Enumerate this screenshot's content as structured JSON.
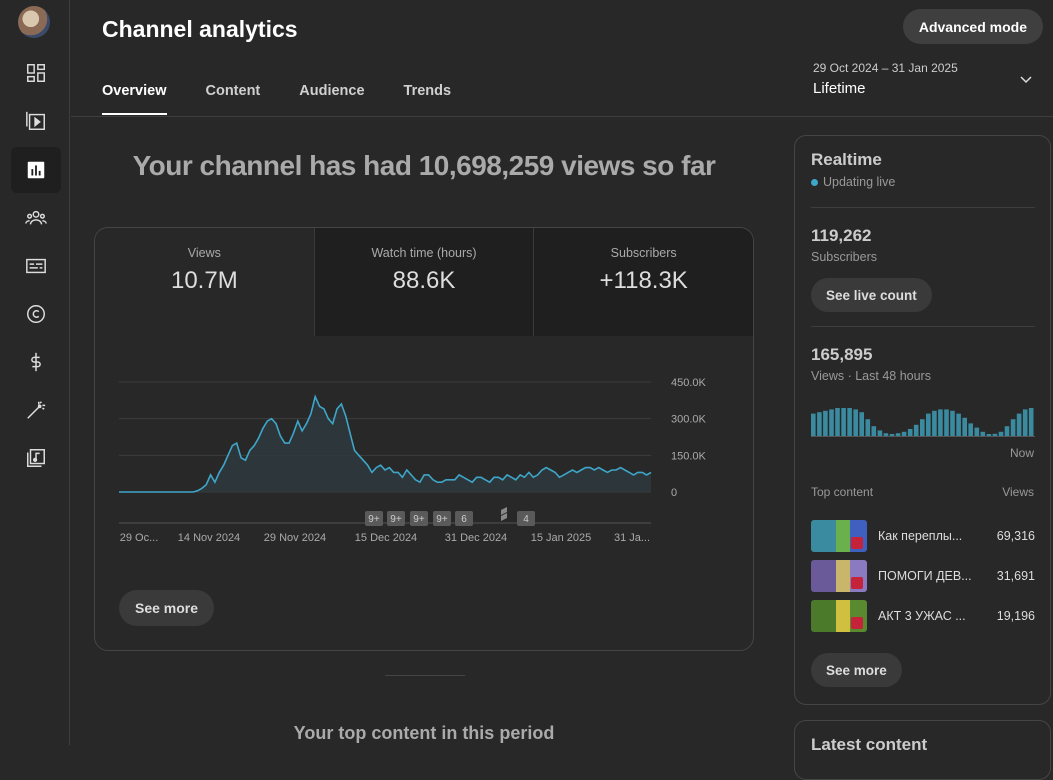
{
  "app": {
    "title": "Channel analytics",
    "advanced_mode": "Advanced mode"
  },
  "sidebar": {
    "items": [
      {
        "icon": "dashboard-icon"
      },
      {
        "icon": "content-icon"
      },
      {
        "icon": "analytics-icon",
        "active": true
      },
      {
        "icon": "community-icon"
      },
      {
        "icon": "subtitles-icon"
      },
      {
        "icon": "copyright-icon"
      },
      {
        "icon": "earn-icon"
      },
      {
        "icon": "customization-icon"
      },
      {
        "icon": "audio-library-icon"
      }
    ]
  },
  "tabs": [
    {
      "label": "Overview",
      "active": true
    },
    {
      "label": "Content"
    },
    {
      "label": "Audience"
    },
    {
      "label": "Trends"
    }
  ],
  "date_filter": {
    "range": "29 Oct 2024 – 31 Jan 2025",
    "value": "Lifetime"
  },
  "headline": "Your channel has had 10,698,259 views so far",
  "metrics": [
    {
      "label": "Views",
      "value": "10.7M"
    },
    {
      "label": "Watch time (hours)",
      "value": "88.6K"
    },
    {
      "label": "Subscribers",
      "value": "+118.3K"
    }
  ],
  "chart_data": {
    "type": "area",
    "series": [
      {
        "values": [
          0,
          0,
          0,
          0,
          0,
          0,
          0,
          0,
          0,
          0,
          0,
          0,
          0,
          0,
          0,
          0,
          0,
          0,
          5000,
          15000,
          30000,
          70000,
          40000,
          80000,
          110000,
          150000,
          190000,
          200000,
          140000,
          130000,
          170000,
          190000,
          220000,
          260000,
          290000,
          300000,
          280000,
          230000,
          200000,
          200000,
          240000,
          290000,
          250000,
          280000,
          320000,
          390000,
          350000,
          340000,
          300000,
          280000,
          340000,
          360000,
          310000,
          240000,
          170000,
          150000,
          130000,
          110000,
          80000,
          100000,
          110000,
          90000,
          100000,
          80000,
          80000,
          60000,
          90000,
          70000,
          50000,
          40000,
          70000,
          70000,
          50000,
          40000,
          40000,
          50000,
          50000,
          50000,
          70000,
          60000,
          50000,
          40000,
          60000,
          60000,
          50000,
          40000,
          60000,
          60000,
          50000,
          70000,
          60000,
          50000,
          70000,
          60000,
          80000,
          60000,
          70000,
          90000,
          100000,
          90000,
          80000,
          60000,
          70000,
          80000,
          90000,
          80000,
          90000,
          100000,
          100000,
          90000,
          100000,
          90000,
          80000,
          90000,
          90000,
          100000,
          90000,
          80000,
          70000,
          80000,
          80000,
          70000,
          80000
        ]
      }
    ],
    "x_ticks": [
      "29 Oc...",
      "14 Nov 2024",
      "29 Nov 2024",
      "15 Dec 2024",
      "31 Dec 2024",
      "15 Jan 2025",
      "31 Ja..."
    ],
    "y_ticks": [
      "450.0K",
      "300.0K",
      "150.0K",
      "0"
    ],
    "ylim": [
      0,
      450000
    ],
    "grid": true,
    "markers": [
      "9+",
      "9+",
      "9+",
      "9+",
      "6",
      "4"
    ]
  },
  "see_more": "See more",
  "top_content_title": "Your top content in this period",
  "realtime": {
    "title": "Realtime",
    "status": "Updating live",
    "subscribers_value": "119,262",
    "subscribers_label": "Subscribers",
    "live_count_btn": "See live count",
    "views_value": "165,895",
    "views_label": "Views · Last 48 hours",
    "bars": [
      80,
      85,
      90,
      95,
      100,
      100,
      100,
      95,
      85,
      60,
      35,
      20,
      10,
      5,
      10,
      15,
      25,
      40,
      60,
      80,
      90,
      95,
      95,
      90,
      80,
      65,
      45,
      30,
      15,
      5,
      8,
      15,
      35,
      60,
      80,
      95,
      100
    ],
    "now_label": "Now",
    "top_content_label": "Top content",
    "views_col_label": "Views",
    "items": [
      {
        "title": "Как переплы...",
        "views": "69,316"
      },
      {
        "title": "ПОМОГИ ДЕВ...",
        "views": "31,691"
      },
      {
        "title": "АКТ 3 УЖАС ...",
        "views": "19,196"
      }
    ],
    "see_more": "See more"
  },
  "latest_content": "Latest content"
}
